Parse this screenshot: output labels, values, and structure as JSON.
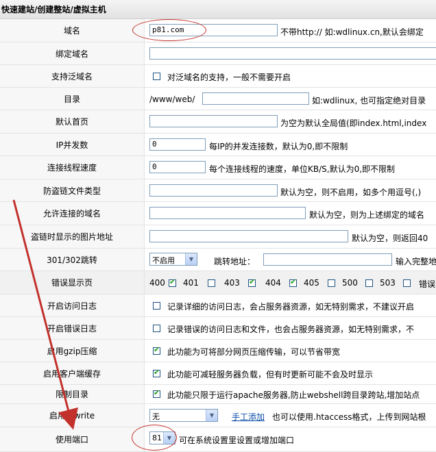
{
  "title": "快速建站/创建整站/虚拟主机",
  "rows": {
    "domain": {
      "label": "域名",
      "value": "p81.com",
      "hint": "不带http:// 如:wdlinux.cn,默认会绑定"
    },
    "bind_domain": {
      "label": "绑定域名",
      "value": ""
    },
    "wildcard": {
      "label": "支持泛域名",
      "hint": "对泛域名的支持，一般不需要开启"
    },
    "dir": {
      "label": "目录",
      "prefix": "/www/web/",
      "value": "",
      "hint": "如:wdlinux, 也可指定绝对目录"
    },
    "index": {
      "label": "默认首页",
      "value": "",
      "hint": "为空为默认全局值(即index.html,index"
    },
    "ip_conn": {
      "label": "IP并发数",
      "value": "0",
      "hint": "每IP的并发连接数，默认为0,即不限制"
    },
    "speed": {
      "label": "连接线程速度",
      "value": "0",
      "hint": "每个连接线程的速度，单位KB/S,默认为0,即不限制"
    },
    "hotlink_types": {
      "label": "防盗链文件类型",
      "value": "",
      "hint": "默认为空，则不启用，如多个用逗号(,)"
    },
    "allowed_domains": {
      "label": "允许连接的域名",
      "value": "",
      "hint": "默认为空，则为上述绑定的域名"
    },
    "hotlink_image": {
      "label": "盗链时显示的图片地址",
      "value": "",
      "hint": "默认为空，则返回40"
    },
    "redirect": {
      "label": "301/302跳转",
      "select": "不启用",
      "addr_label": "跳转地址：",
      "addr_value": "",
      "hint": "输入完整地"
    },
    "error_pages": {
      "label": "错误显示页",
      "items": [
        {
          "code": "400",
          "checked": true
        },
        {
          "code": "401",
          "checked": false
        },
        {
          "code": "403",
          "checked": true
        },
        {
          "code": "404",
          "checked": true
        },
        {
          "code": "405",
          "checked": false
        },
        {
          "code": "500",
          "checked": false
        },
        {
          "code": "503",
          "checked": false
        },
        {
          "code": "错误页",
          "checked": false
        }
      ]
    },
    "access_log": {
      "label": "开启访问日志",
      "hint": "记录详细的访问日志，会占服务器资源，如无特别需求，不建议开启"
    },
    "error_log": {
      "label": "开启错误日志",
      "hint": "记录错误的访问日志和文件，也会占服务器资源，如无特别需求，不"
    },
    "gzip": {
      "label": "启用gzip压缩",
      "hint": "此功能为可将部分网页压缩传输，可以节省带宽"
    },
    "client_cache": {
      "label": "启用客户端缓存",
      "hint": "此功能可减轻服务器负载，但有时更新可能不会及时显示"
    },
    "restrict_dir": {
      "label": "限制目录",
      "hint": "此功能只限于运行apache服务器,防止webshell跨目录跨站,增加站点"
    },
    "rewrite": {
      "label": "启用rewrite",
      "select": "无",
      "link": "手工添加",
      "hint": "也可以使用.htaccess格式，上传到网站根"
    },
    "port": {
      "label": "使用端口",
      "select": "81",
      "hint": "可在系统设置里设置或增加端口"
    }
  },
  "colors": {
    "annotation": "#c2312b",
    "check": "#21a121",
    "link": "#0b4ca8"
  }
}
